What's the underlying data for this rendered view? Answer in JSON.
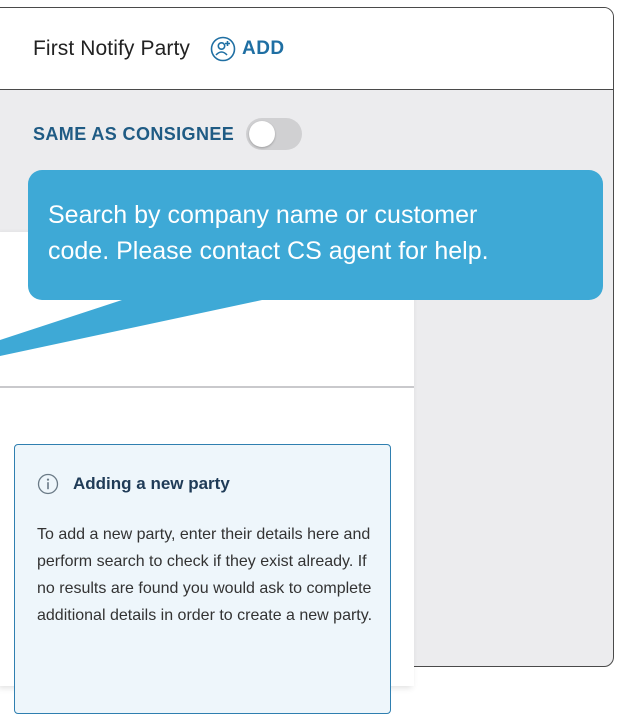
{
  "notify_card": {
    "title": "First Notify Party",
    "add_label": "ADD",
    "same_as_label": "SAME AS CONSIGNEE",
    "same_as_enabled": false
  },
  "tooltip": {
    "text": "Search by company name or customer\ncode. Please contact CS agent for help."
  },
  "info_box": {
    "title": "Adding a new party",
    "body": "To add a new party, enter their details here and perform search to check if they exist already. If no results are found you would ask to complete additional details in order to create a new party."
  },
  "colors": {
    "tooltip_bg": "#3ea9d6",
    "accent": "#1f6fa3",
    "card_bg": "#ececee"
  },
  "icons": {
    "add": "add-user-icon",
    "info": "info-icon"
  }
}
